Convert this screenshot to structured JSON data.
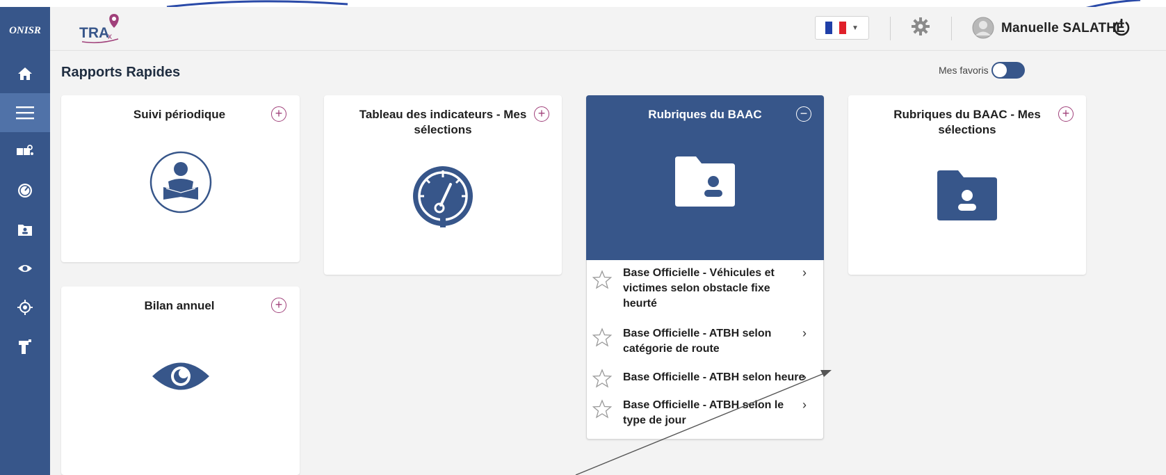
{
  "app": {
    "sidebar_logo": "ONISR",
    "header_logo": "TRAX"
  },
  "header": {
    "language": "fr",
    "user_name": "Manuelle SALATHÉ"
  },
  "page": {
    "title": "Rapports Rapides",
    "favorites_label": "Mes favoris"
  },
  "sidebar": {
    "items": [
      {
        "icon": "home-icon"
      },
      {
        "icon": "menu-icon",
        "active": true
      },
      {
        "icon": "puzzle-icon"
      },
      {
        "icon": "gauge-icon"
      },
      {
        "icon": "folder-user-icon"
      },
      {
        "icon": "eye-icon"
      },
      {
        "icon": "target-icon"
      },
      {
        "icon": "pin-icon"
      }
    ]
  },
  "cards": {
    "suivi": {
      "title": "Suivi périodique"
    },
    "tableau": {
      "title": "Tableau des indicateurs - Mes sélections"
    },
    "rubriques": {
      "title": "Rubriques du BAAC"
    },
    "rubriques_mes": {
      "title": "Rubriques du BAAC - Mes sélections"
    },
    "bilan": {
      "title": "Bilan annuel"
    }
  },
  "rubriques_list": [
    {
      "label": "Base Officielle - Véhicules et victimes selon obstacle fixe heurté"
    },
    {
      "label": "Base Officielle - ATBH selon catégorie de route"
    },
    {
      "label": "Base Officielle - ATBH selon heure"
    },
    {
      "label": "Base Officielle - ATBH selon le type de jour"
    }
  ],
  "colors": {
    "primary": "#37568a",
    "accent": "#a0407a",
    "background": "#f3f3f3"
  }
}
